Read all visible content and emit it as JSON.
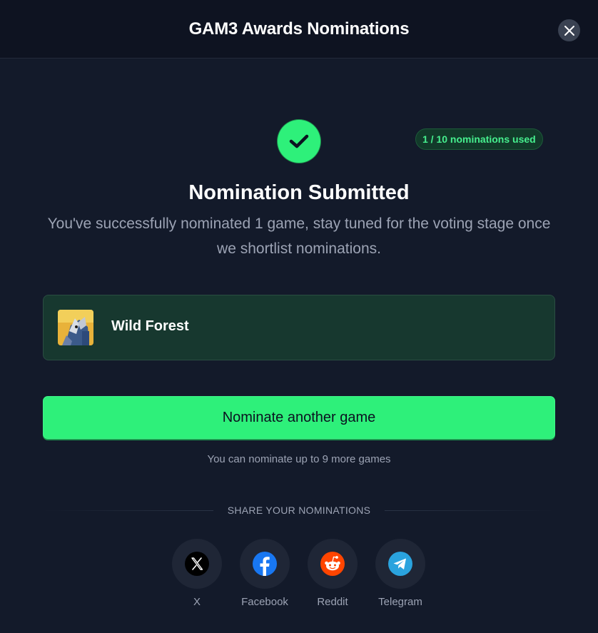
{
  "header": {
    "title": "GAM3 Awards Nominations"
  },
  "status": {
    "badge": "1 / 10 nominations used",
    "title": "Nomination Submitted",
    "subtitle": "You've successfully nominated 1 game, stay tuned for the voting stage once we shortlist nominations."
  },
  "nominated_game": {
    "name": "Wild Forest"
  },
  "cta": {
    "label": "Nominate another game"
  },
  "hint": "You can nominate up to 9 more games",
  "share": {
    "heading": "SHARE YOUR NOMINATIONS",
    "items": [
      {
        "label": "X",
        "icon": "x-icon"
      },
      {
        "label": "Facebook",
        "icon": "facebook-icon"
      },
      {
        "label": "Reddit",
        "icon": "reddit-icon"
      },
      {
        "label": "Telegram",
        "icon": "telegram-icon"
      }
    ]
  },
  "colors": {
    "accent": "#2ef07a",
    "background": "#131a2a",
    "header": "#0e1321",
    "card": "#17382f"
  }
}
